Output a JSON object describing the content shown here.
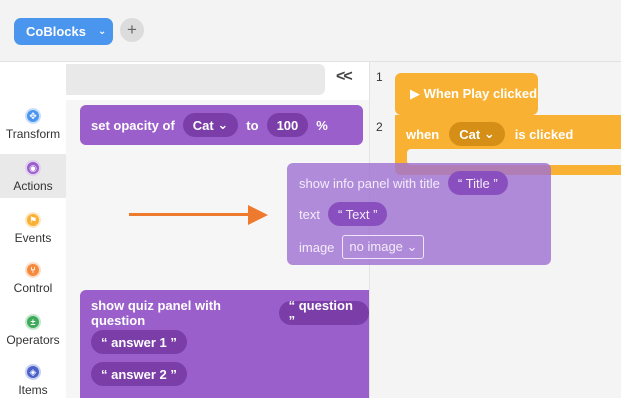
{
  "header": {
    "project_label": "CoBlocks",
    "project_chevron": "⌄",
    "add_label": "+"
  },
  "search": {
    "collapse_label": "<<"
  },
  "categories": [
    {
      "label": "Transform",
      "color": "#4a95ee",
      "icon": "transform-icon"
    },
    {
      "label": "Actions",
      "color": "#9a5fcb",
      "icon": "actions-icon"
    },
    {
      "label": "Events",
      "color": "#f8b133",
      "icon": "events-icon"
    },
    {
      "label": "Control",
      "color": "#f58a3c",
      "icon": "control-icon"
    },
    {
      "label": "Operators",
      "color": "#3dab5a",
      "icon": "operators-icon"
    },
    {
      "label": "Items",
      "color": "#4a62c9",
      "icon": "items-icon"
    }
  ],
  "palette": {
    "opacity_block": {
      "prefix": "set opacity of",
      "target": "Cat",
      "to_label": "to",
      "value": "100",
      "unit": "%"
    },
    "quiz_block": {
      "prefix": "show quiz panel with question",
      "question": "“ question ”",
      "answer1": "“ answer 1 ”",
      "answer2": "“ answer 2 ”"
    }
  },
  "workspace": {
    "line1": "1",
    "line2": "2",
    "play_block": "▶ When Play clicked",
    "when_block": {
      "prefix": "when",
      "target": "Cat",
      "suffix": "is clicked"
    }
  },
  "dragged_block": {
    "title_label": "show info panel with title",
    "title_value": "“ Title ”",
    "text_label": "text",
    "text_value": "“ Text ”",
    "image_label": "image",
    "image_value": "no image ⌄"
  },
  "colors": {
    "accent_blue": "#4a95ee",
    "block_purple": "#9a5fcb",
    "block_orange": "#f8b133",
    "arrow": "#ee7a2e"
  }
}
